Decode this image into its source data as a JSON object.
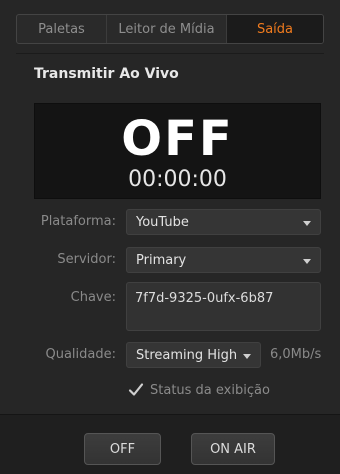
{
  "tabs": [
    {
      "label": "Paletas"
    },
    {
      "label": "Leitor de Mídia"
    },
    {
      "label": "Saída"
    }
  ],
  "accent_color": "#f07b1e",
  "section": {
    "title": "Transmitir Ao Vivo"
  },
  "display": {
    "status": "OFF",
    "timer": "00:00:00"
  },
  "form": {
    "platform": {
      "label": "Plataforma:",
      "value": "YouTube"
    },
    "server": {
      "label": "Servidor:",
      "value": "Primary"
    },
    "key": {
      "label": "Chave:",
      "value": "7f7d-9325-0ufx-6b87"
    },
    "quality": {
      "label": "Qualidade:",
      "value": "Streaming High",
      "rate": "6,0Mb/s"
    },
    "status_display": {
      "label": "Status da exibição",
      "checked": true
    }
  },
  "buttons": {
    "off": "OFF",
    "on_air": "ON AIR"
  }
}
